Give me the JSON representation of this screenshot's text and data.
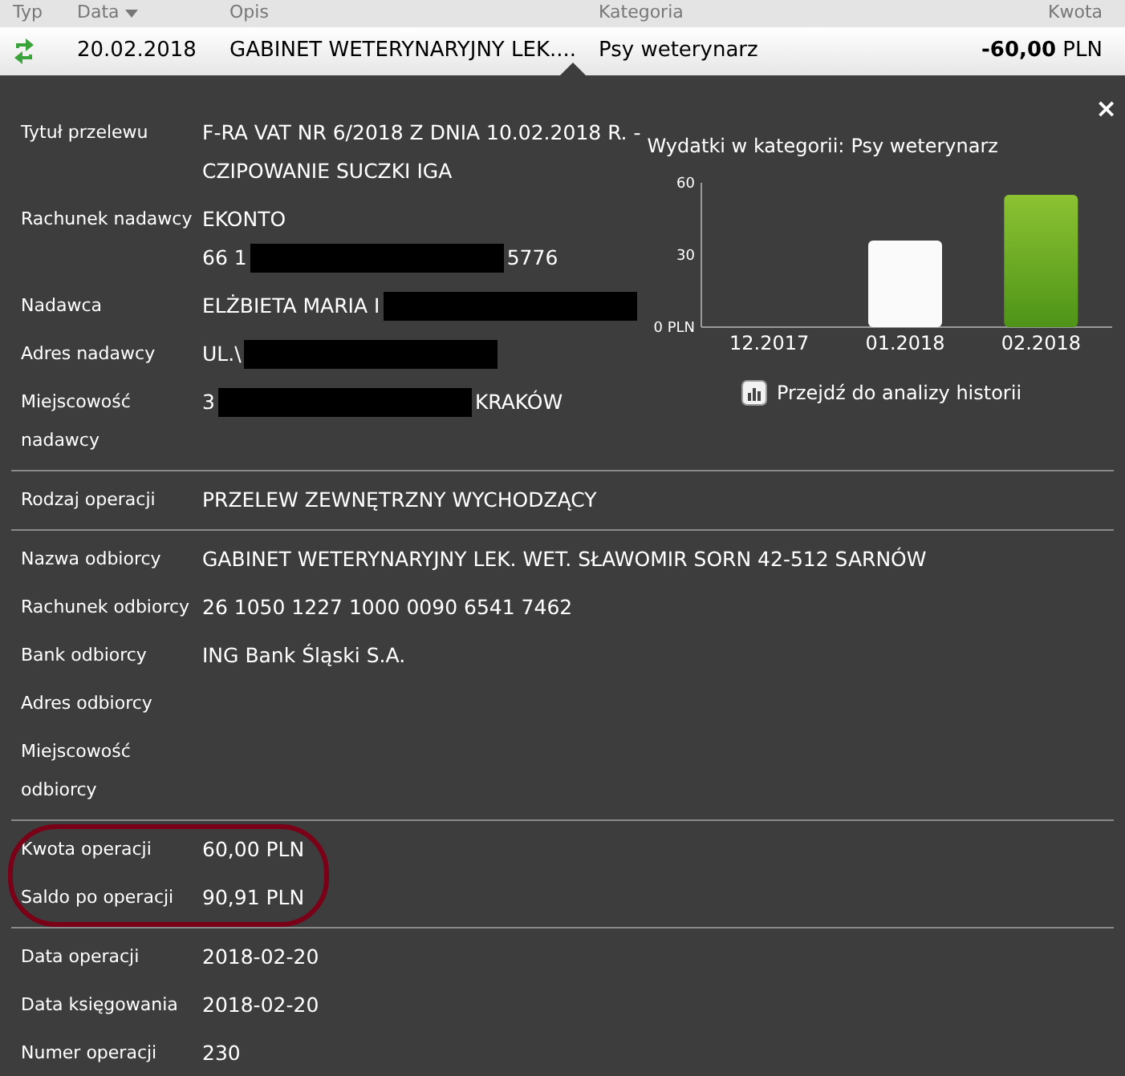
{
  "table": {
    "columns": [
      {
        "label": "Typ",
        "sorted": false
      },
      {
        "label": "Data",
        "sorted": true
      },
      {
        "label": "Opis",
        "sorted": false
      },
      {
        "label": "Kategoria",
        "sorted": false
      },
      {
        "label": "Kwota",
        "sorted": false
      }
    ],
    "row": {
      "date": "20.02.2018",
      "description": "GABINET WETERYNARYJNY LEK....",
      "category": "Psy weterynarz",
      "amount": "**-60,00** PLN"
    }
  },
  "details": {
    "close": "×",
    "groups": [
      {
        "highlighted": false,
        "rows": [
          {
            "label": "Tytuł przelewu",
            "lines": [
              [
                {
                  "kind": "text",
                  "text": "F-RA VAT NR 6/2018 Z DNIA 10.02.2018 R. -"
                }
              ],
              [
                {
                  "kind": "text",
                  "text": "CZIPOWANIE SUCZKI IGA"
                }
              ]
            ]
          },
          {
            "label": "Rachunek nadawcy",
            "lines": [
              [
                {
                  "kind": "text",
                  "text": "EKONTO"
                }
              ],
              [
                {
                  "kind": "text",
                  "text": "66 1"
                },
                {
                  "kind": "redacted"
                },
                {
                  "kind": "text",
                  "text": "5776"
                }
              ]
            ]
          },
          {
            "label": "Nadawca",
            "lines": [
              [
                {
                  "kind": "text",
                  "text": "ELŻBIETA MARIA I"
                },
                {
                  "kind": "redacted"
                }
              ]
            ]
          },
          {
            "label": "Adres nadawcy",
            "lines": [
              [
                {
                  "kind": "text",
                  "text": "UL.\\"
                },
                {
                  "kind": "redacted"
                }
              ]
            ]
          },
          {
            "label": "Miejscowość nadawcy",
            "lines": [
              [
                {
                  "kind": "text",
                  "text": "3"
                },
                {
                  "kind": "redacted"
                },
                {
                  "kind": "text",
                  "text": "KRAKÓW"
                }
              ]
            ]
          }
        ]
      },
      {
        "highlighted": false,
        "rows": [
          {
            "label": "Rodzaj operacji",
            "lines": [
              [
                {
                  "kind": "text",
                  "text": "PRZELEW ZEWNĘTRZNY WYCHODZĄCY"
                }
              ]
            ]
          }
        ]
      },
      {
        "highlighted": false,
        "rows": [
          {
            "label": "Nazwa odbiorcy",
            "lines": [
              [
                {
                  "kind": "text",
                  "text": "GABINET WETERYNARYJNY LEK. WET. SŁAWOMIR SORN 42-512 SARNÓW"
                }
              ]
            ]
          },
          {
            "label": "Rachunek odbiorcy",
            "lines": [
              [
                {
                  "kind": "text",
                  "text": "26 1050 1227 1000 0090 6541 7462"
                }
              ]
            ]
          },
          {
            "label": "Bank odbiorcy",
            "lines": [
              [
                {
                  "kind": "text",
                  "text": "ING Bank Śląski S.A."
                }
              ]
            ]
          },
          {
            "label": "Adres odbiorcy",
            "lines": []
          },
          {
            "label": "Miejscowość odbiorcy",
            "lines": []
          }
        ]
      },
      {
        "highlighted": true,
        "rows": [
          {
            "label": "Kwota operacji",
            "lines": [
              [
                {
                  "kind": "text",
                  "text": "60,00 PLN"
                }
              ]
            ]
          },
          {
            "label": "Saldo po operacji",
            "lines": [
              [
                {
                  "kind": "text",
                  "text": "90,91 PLN"
                }
              ]
            ]
          }
        ]
      },
      {
        "highlighted": false,
        "rows": [
          {
            "label": "Data operacji",
            "lines": [
              [
                {
                  "kind": "text",
                  "text": "2018-02-20"
                }
              ]
            ]
          },
          {
            "label": "Data księgowania",
            "lines": [
              [
                {
                  "kind": "text",
                  "text": "2018-02-20"
                }
              ]
            ]
          },
          {
            "label": "Numer operacji",
            "lines": [
              [
                {
                  "kind": "text",
                  "text": "230"
                }
              ]
            ]
          }
        ]
      }
    ],
    "chart": {
      "heading": "Wydatki w kategorii:",
      "category": "Psy weterynarz",
      "link": "Przejdź do analizy historii",
      "chart_data": {
        "type": "bar",
        "categories": [
          "12.2017",
          "01.2018",
          "02.2018"
        ],
        "series": [
          {
            "values": [
              0,
              36,
              55
            ]
          }
        ],
        "ylim": [
          0,
          60
        ],
        "yticks": [
          {
            "value": 0,
            "label": "0 PLN"
          },
          30,
          60
        ]
      }
    }
  }
}
